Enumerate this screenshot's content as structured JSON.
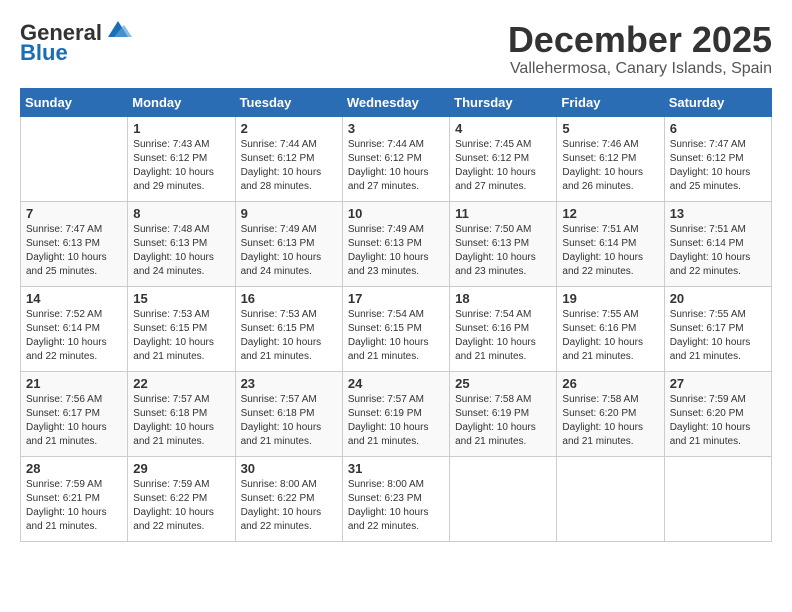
{
  "header": {
    "logo_general": "General",
    "logo_blue": "Blue",
    "title": "December 2025",
    "subtitle": "Vallehermosa, Canary Islands, Spain"
  },
  "days_of_week": [
    "Sunday",
    "Monday",
    "Tuesday",
    "Wednesday",
    "Thursday",
    "Friday",
    "Saturday"
  ],
  "weeks": [
    [
      {
        "day": "",
        "data": ""
      },
      {
        "day": "1",
        "data": "Sunrise: 7:43 AM\nSunset: 6:12 PM\nDaylight: 10 hours\nand 29 minutes."
      },
      {
        "day": "2",
        "data": "Sunrise: 7:44 AM\nSunset: 6:12 PM\nDaylight: 10 hours\nand 28 minutes."
      },
      {
        "day": "3",
        "data": "Sunrise: 7:44 AM\nSunset: 6:12 PM\nDaylight: 10 hours\nand 27 minutes."
      },
      {
        "day": "4",
        "data": "Sunrise: 7:45 AM\nSunset: 6:12 PM\nDaylight: 10 hours\nand 27 minutes."
      },
      {
        "day": "5",
        "data": "Sunrise: 7:46 AM\nSunset: 6:12 PM\nDaylight: 10 hours\nand 26 minutes."
      },
      {
        "day": "6",
        "data": "Sunrise: 7:47 AM\nSunset: 6:12 PM\nDaylight: 10 hours\nand 25 minutes."
      }
    ],
    [
      {
        "day": "7",
        "data": "Sunrise: 7:47 AM\nSunset: 6:13 PM\nDaylight: 10 hours\nand 25 minutes."
      },
      {
        "day": "8",
        "data": "Sunrise: 7:48 AM\nSunset: 6:13 PM\nDaylight: 10 hours\nand 24 minutes."
      },
      {
        "day": "9",
        "data": "Sunrise: 7:49 AM\nSunset: 6:13 PM\nDaylight: 10 hours\nand 24 minutes."
      },
      {
        "day": "10",
        "data": "Sunrise: 7:49 AM\nSunset: 6:13 PM\nDaylight: 10 hours\nand 23 minutes."
      },
      {
        "day": "11",
        "data": "Sunrise: 7:50 AM\nSunset: 6:13 PM\nDaylight: 10 hours\nand 23 minutes."
      },
      {
        "day": "12",
        "data": "Sunrise: 7:51 AM\nSunset: 6:14 PM\nDaylight: 10 hours\nand 22 minutes."
      },
      {
        "day": "13",
        "data": "Sunrise: 7:51 AM\nSunset: 6:14 PM\nDaylight: 10 hours\nand 22 minutes."
      }
    ],
    [
      {
        "day": "14",
        "data": "Sunrise: 7:52 AM\nSunset: 6:14 PM\nDaylight: 10 hours\nand 22 minutes."
      },
      {
        "day": "15",
        "data": "Sunrise: 7:53 AM\nSunset: 6:15 PM\nDaylight: 10 hours\nand 21 minutes."
      },
      {
        "day": "16",
        "data": "Sunrise: 7:53 AM\nSunset: 6:15 PM\nDaylight: 10 hours\nand 21 minutes."
      },
      {
        "day": "17",
        "data": "Sunrise: 7:54 AM\nSunset: 6:15 PM\nDaylight: 10 hours\nand 21 minutes."
      },
      {
        "day": "18",
        "data": "Sunrise: 7:54 AM\nSunset: 6:16 PM\nDaylight: 10 hours\nand 21 minutes."
      },
      {
        "day": "19",
        "data": "Sunrise: 7:55 AM\nSunset: 6:16 PM\nDaylight: 10 hours\nand 21 minutes."
      },
      {
        "day": "20",
        "data": "Sunrise: 7:55 AM\nSunset: 6:17 PM\nDaylight: 10 hours\nand 21 minutes."
      }
    ],
    [
      {
        "day": "21",
        "data": "Sunrise: 7:56 AM\nSunset: 6:17 PM\nDaylight: 10 hours\nand 21 minutes."
      },
      {
        "day": "22",
        "data": "Sunrise: 7:57 AM\nSunset: 6:18 PM\nDaylight: 10 hours\nand 21 minutes."
      },
      {
        "day": "23",
        "data": "Sunrise: 7:57 AM\nSunset: 6:18 PM\nDaylight: 10 hours\nand 21 minutes."
      },
      {
        "day": "24",
        "data": "Sunrise: 7:57 AM\nSunset: 6:19 PM\nDaylight: 10 hours\nand 21 minutes."
      },
      {
        "day": "25",
        "data": "Sunrise: 7:58 AM\nSunset: 6:19 PM\nDaylight: 10 hours\nand 21 minutes."
      },
      {
        "day": "26",
        "data": "Sunrise: 7:58 AM\nSunset: 6:20 PM\nDaylight: 10 hours\nand 21 minutes."
      },
      {
        "day": "27",
        "data": "Sunrise: 7:59 AM\nSunset: 6:20 PM\nDaylight: 10 hours\nand 21 minutes."
      }
    ],
    [
      {
        "day": "28",
        "data": "Sunrise: 7:59 AM\nSunset: 6:21 PM\nDaylight: 10 hours\nand 21 minutes."
      },
      {
        "day": "29",
        "data": "Sunrise: 7:59 AM\nSunset: 6:22 PM\nDaylight: 10 hours\nand 22 minutes."
      },
      {
        "day": "30",
        "data": "Sunrise: 8:00 AM\nSunset: 6:22 PM\nDaylight: 10 hours\nand 22 minutes."
      },
      {
        "day": "31",
        "data": "Sunrise: 8:00 AM\nSunset: 6:23 PM\nDaylight: 10 hours\nand 22 minutes."
      },
      {
        "day": "",
        "data": ""
      },
      {
        "day": "",
        "data": ""
      },
      {
        "day": "",
        "data": ""
      }
    ]
  ]
}
